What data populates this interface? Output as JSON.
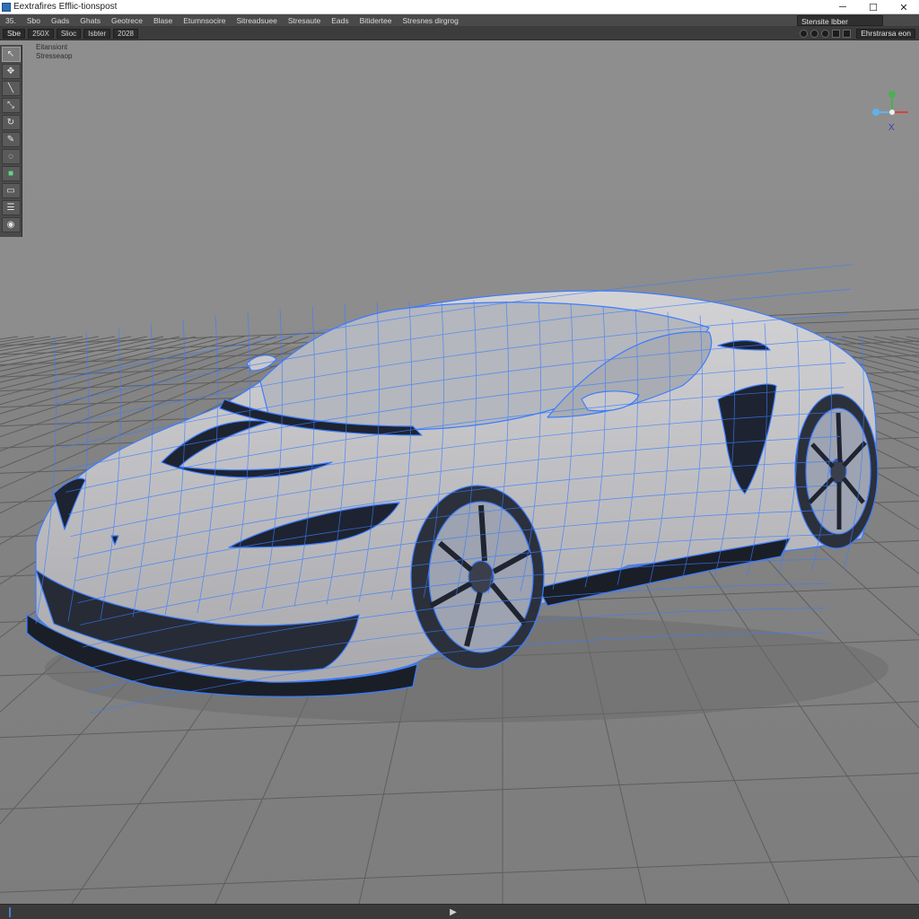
{
  "window": {
    "title": "Eextrafires Efflic-tionspost",
    "controls": {
      "minimize": "─",
      "maximize": "☐",
      "close": "✕"
    }
  },
  "menubar": {
    "items": [
      "35.",
      "Sbo",
      "Gads",
      "Ghats",
      "Geotrece",
      "Blase",
      "Etumnsocire",
      "Sitreadsuee",
      "Stresaute",
      "Eads",
      "Bitidertee",
      "Stresnes dirgrog"
    ],
    "search_value": "Stensite lbber"
  },
  "toolbar": {
    "left_label": "Sbe",
    "buttons": [
      "250X",
      "Slioc",
      "Isbter",
      "2028"
    ],
    "right_label": "Ehrstrarsa eon"
  },
  "viewport": {
    "info_line1": "Eitansiont",
    "info_line2": "Stresseaop",
    "gizmo_axis_label": "X"
  },
  "colors": {
    "wire": "#3c7cff",
    "body": "#c3c3c7",
    "grid": "#5a5a5a",
    "accent": "#4a7ec9"
  },
  "icons": {
    "tools": [
      "select-arrow-icon",
      "move-icon",
      "line-tool-icon",
      "scale-icon",
      "rotate-icon",
      "edit-icon",
      "lasso-icon",
      "material-icon",
      "document-icon",
      "layers-icon",
      "camera-icon"
    ],
    "bottom": "play-icon"
  }
}
